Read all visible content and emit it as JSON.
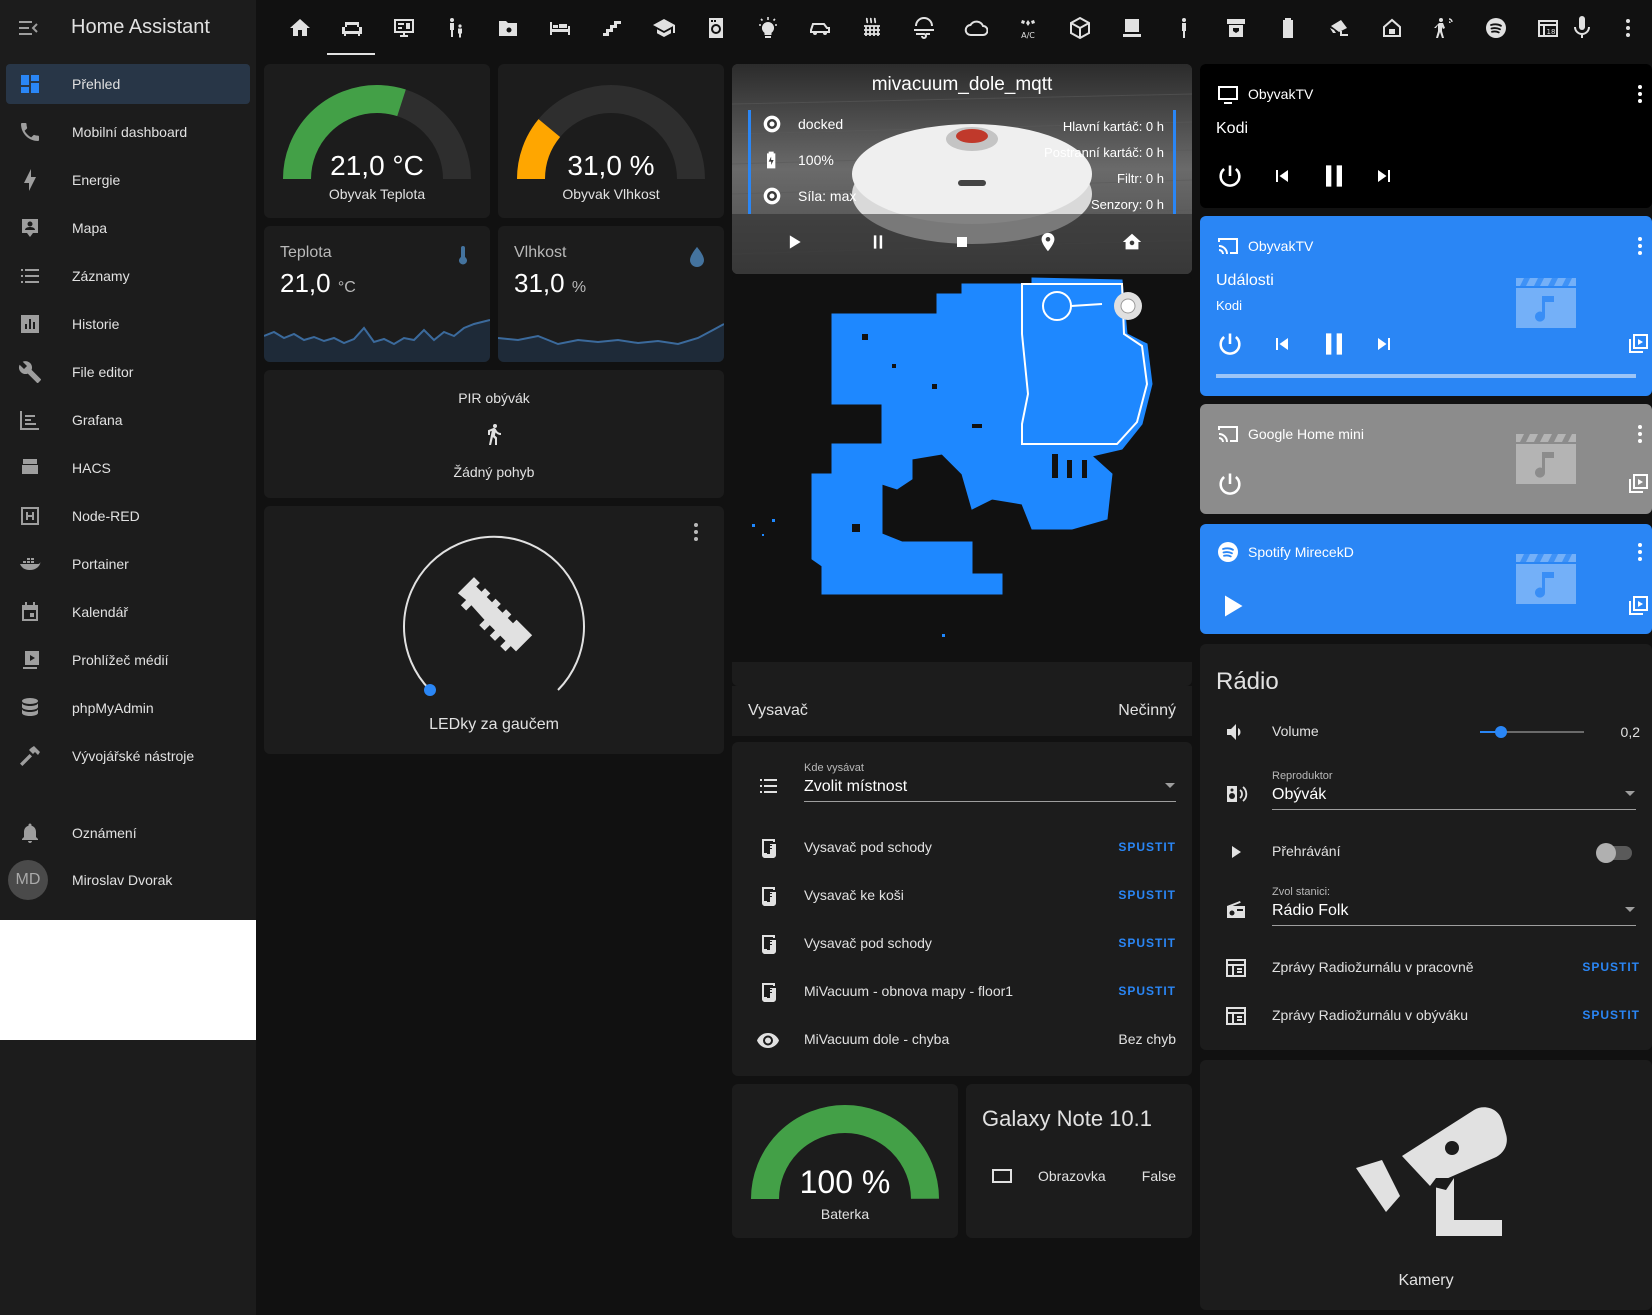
{
  "app": {
    "title": "Home Assistant"
  },
  "sidebar": {
    "items": [
      {
        "label": "Přehled",
        "icon": "dashboard-icon"
      },
      {
        "label": "Mobilní dashboard",
        "icon": "phone-icon"
      },
      {
        "label": "Energie",
        "icon": "lightning-icon"
      },
      {
        "label": "Mapa",
        "icon": "map-account-icon"
      },
      {
        "label": "Záznamy",
        "icon": "list-icon"
      },
      {
        "label": "Historie",
        "icon": "chart-box-icon"
      },
      {
        "label": "File editor",
        "icon": "wrench-icon"
      },
      {
        "label": "Grafana",
        "icon": "chart-timeline-icon"
      },
      {
        "label": "HACS",
        "icon": "hacs-icon"
      },
      {
        "label": "Node-RED",
        "icon": "sitemap-icon"
      },
      {
        "label": "Portainer",
        "icon": "docker-icon"
      },
      {
        "label": "Kalendář",
        "icon": "calendar-icon"
      },
      {
        "label": "Prohlížeč médií",
        "icon": "play-box-multiple-icon"
      },
      {
        "label": "phpMyAdmin",
        "icon": "database-icon"
      },
      {
        "label": "Vývojářské nástroje",
        "icon": "hammer-icon"
      }
    ],
    "notifications": {
      "label": "Oznámení",
      "icon": "bell-icon"
    },
    "user": {
      "label": "Miroslav Dvorak",
      "initials": "MD"
    }
  },
  "toolbar": {
    "icons": [
      "home-icon",
      "sofa-icon",
      "monitor-dashboard-icon",
      "human-male-child-icon",
      "folder-icon",
      "bed-icon",
      "stairs-icon",
      "school-icon",
      "washing-machine-icon",
      "lightbulb-icon",
      "car-icon",
      "radiator-icon",
      "weather-windy-icon",
      "cloud-icon",
      "air-conditioner-icon",
      "cube-icon",
      "desktop-icon",
      "human-icon",
      "printer-3d-icon",
      "battery-icon",
      "cctv-icon",
      "home-lock-icon",
      "motion-sensor-icon",
      "spotify-icon",
      "calendar-today-icon",
      "microphone-icon",
      "dots-vertical-icon"
    ]
  },
  "gauges": {
    "temp": {
      "value": "21,0 °C",
      "name": "Obyvak Teplota",
      "fraction": 0.6,
      "color": "#43a047"
    },
    "hum": {
      "value": "31,0 %",
      "name": "Obyvak Vlhkost",
      "fraction": 0.22,
      "color": "#ffa600"
    }
  },
  "sensors": {
    "temp": {
      "name": "Teplota",
      "value": "21,0",
      "unit": "°C"
    },
    "hum": {
      "name": "Vlhkost",
      "value": "31,0",
      "unit": "%"
    }
  },
  "pir": {
    "title": "PIR obývák",
    "state": "Žádný pohyb"
  },
  "light": {
    "name": "LEDky za gaučem"
  },
  "vacuum": {
    "name": "mivacuum_dole_mqtt",
    "status": "docked",
    "battery": "100%",
    "power": "Síla: max",
    "stats": [
      "Hlavní kartáč: 0 h",
      "Postranní kartáč: 0 h",
      "Filtr: 0 h",
      "Senzory: 0 h"
    ],
    "footer_name": "Vysavač",
    "footer_state": "Nečinný"
  },
  "vac_entities": {
    "select": {
      "label": "Kde vysávat",
      "value": "Zvolit místnost"
    },
    "scripts": [
      {
        "name": "Vysavač pod schody",
        "action": "SPUSTIT"
      },
      {
        "name": "Vysavač ke koši",
        "action": "SPUSTIT"
      },
      {
        "name": "Vysavač pod schody",
        "action": "SPUSTIT"
      },
      {
        "name": "MiVacuum - obnova mapy - floor1",
        "action": "SPUSTIT"
      }
    ],
    "sensor": {
      "name": "MiVacuum dole - chyba",
      "state": "Bez chyb"
    }
  },
  "battery_gauge": {
    "value": "100 %",
    "name": "Baterka",
    "fraction": 1.0,
    "color": "#43a047"
  },
  "galaxy": {
    "title": "Galaxy Note 10.1",
    "entity": "Obrazovka",
    "state": "False"
  },
  "media": {
    "tv1": {
      "name": "ObyvakTV",
      "title": "Kodi"
    },
    "tv2": {
      "name": "ObyvakTV",
      "title": "Události",
      "subtitle": "Kodi",
      "color": "#2a86f5"
    },
    "ghm": {
      "name": "Google Home mini",
      "color": "#8c8c8c"
    },
    "spotify": {
      "name": "Spotify MirecekD",
      "color": "#2a86f5"
    }
  },
  "radio": {
    "title": "Rádio",
    "volume": {
      "name": "Volume",
      "value": "0,2",
      "level": 0.2
    },
    "speaker": {
      "label": "Reproduktor",
      "value": "Obývák"
    },
    "playback": {
      "name": "Přehrávání"
    },
    "station": {
      "label": "Zvol stanici:",
      "value": "Rádio Folk"
    },
    "scripts": [
      {
        "name": "Zprávy Radiožurnálu v pracovně",
        "action": "SPUSTIT"
      },
      {
        "name": "Zprávy Radiožurnálu v obýváku",
        "action": "SPUSTIT"
      }
    ]
  },
  "cameras": {
    "name": "Kamery"
  }
}
